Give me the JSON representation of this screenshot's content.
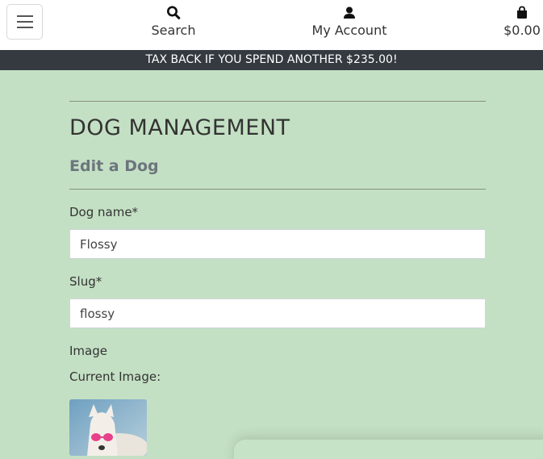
{
  "header": {
    "nav": {
      "search_label": "Search",
      "account_label": "My Account",
      "bag_total": "$0.00"
    },
    "icons": {
      "menu": "hamburger-icon",
      "search": "search-icon",
      "account": "user-icon",
      "bag": "shopping-bag-icon"
    }
  },
  "banner": {
    "text": "TAX BACK IF YOU SPEND ANOTHER $235.00!"
  },
  "main": {
    "title": "DOG MANAGEMENT",
    "subtitle": "Edit a Dog",
    "form": {
      "name_label": "Dog name*",
      "name_value": "Flossy",
      "slug_label": "Slug*",
      "slug_value": "flossy",
      "image_label": "Image",
      "current_image_label": "Current Image:"
    }
  },
  "colors": {
    "page_background": "#c4e0c4",
    "banner_background": "#343a40",
    "header_background": "#ffffff"
  }
}
